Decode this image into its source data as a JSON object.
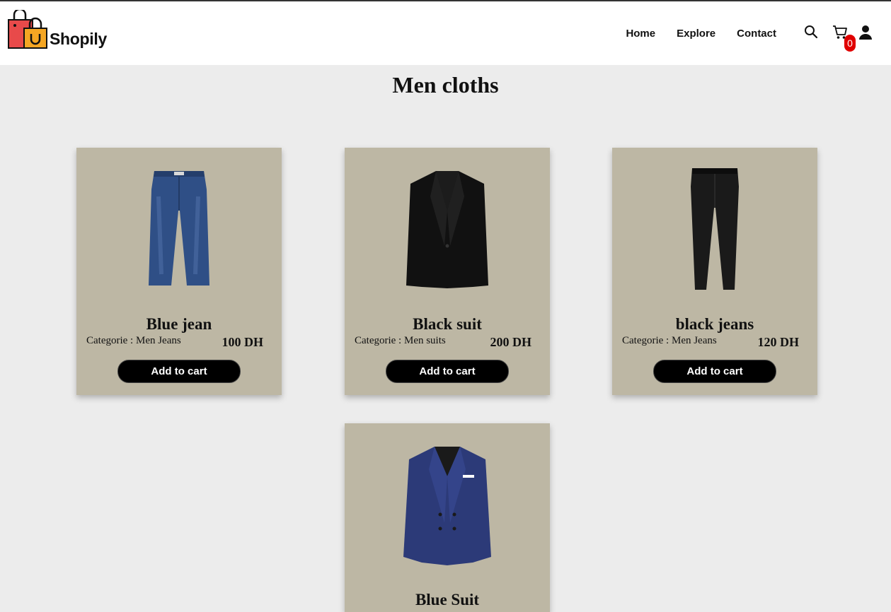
{
  "brand": {
    "name": "Shopily"
  },
  "nav": {
    "links": [
      "Home",
      "Explore",
      "Contact"
    ],
    "cart_count": "0",
    "icons": [
      "search-icon",
      "cart-icon",
      "user-icon"
    ]
  },
  "page": {
    "title": "Men cloths"
  },
  "products": [
    {
      "name": "Blue jean",
      "category": "Categorie : Men Jeans",
      "price": "100 DH",
      "button": "Add to cart",
      "image": "blue-jeans"
    },
    {
      "name": "Black suit",
      "category": "Categorie : Men suits",
      "price": "200 DH",
      "button": "Add to cart",
      "image": "black-suit-jacket"
    },
    {
      "name": "black jeans",
      "category": "Categorie : Men Jeans",
      "price": "120 DH",
      "button": "Add to cart",
      "image": "black-jeans"
    },
    {
      "name": "Blue Suit",
      "category": "",
      "price": "",
      "button": "",
      "image": "blue-suit-jacket"
    }
  ],
  "colors": {
    "card_bg": "#bdb7a4",
    "page_bg": "#ececec",
    "badge": "#e00000",
    "button": "#000000"
  }
}
